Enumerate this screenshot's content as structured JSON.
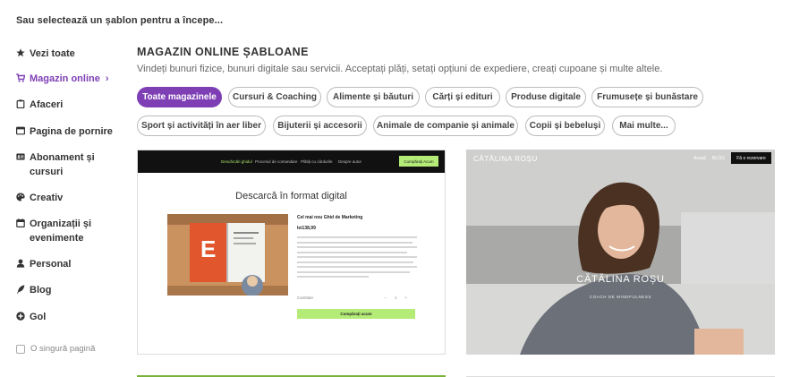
{
  "header": {
    "hint": "Sau selectează un șablon pentru a începe..."
  },
  "sidebar": {
    "items": [
      {
        "label": "Vezi toate",
        "icon": "star-icon"
      },
      {
        "label": "Magazin online",
        "icon": "cart-icon",
        "active": true,
        "chevron": "›"
      },
      {
        "label": "Afaceri",
        "icon": "clipboard-icon"
      },
      {
        "label": "Pagina de pornire",
        "icon": "browser-window-icon"
      },
      {
        "label": "Abonament și cursuri",
        "icon": "id-card-icon"
      },
      {
        "label": "Creativ",
        "icon": "palette-icon"
      },
      {
        "label": "Organizații și evenimente",
        "icon": "calendar-icon"
      },
      {
        "label": "Personal",
        "icon": "user-icon"
      },
      {
        "label": "Blog",
        "icon": "quill-icon"
      },
      {
        "label": "Gol",
        "icon": "plus-circle-icon"
      }
    ],
    "single_page_label": "O singură pagină"
  },
  "main": {
    "title": "MAGAZIN ONLINE ȘABLOANE",
    "description": "Vindeți bunuri fizice, bunuri digitale sau servicii. Acceptați plăți, setați opțiuni de expediere, creați cupoane și multe altele.",
    "filters": [
      {
        "label": "Toate magazinele",
        "active": true
      },
      {
        "label": "Cursuri & Coaching"
      },
      {
        "label": "Alimente și băuturi"
      },
      {
        "label": "Cărți și edituri"
      },
      {
        "label": "Produse digitale"
      },
      {
        "label": "Frumusețe și bunăstare"
      },
      {
        "label": "Sport și activități în aer liber"
      },
      {
        "label": "Bijuterii și accesorii"
      },
      {
        "label": "Animale de companie și animale"
      },
      {
        "label": "Copii și bebeluși"
      },
      {
        "label": "Mai multe..."
      }
    ]
  },
  "templates": {
    "digital": {
      "nav": [
        "Descărcări ghidul",
        "Procesul de comandare",
        "Plătiți cu cârdurile",
        "Despre autor"
      ],
      "nav_button": "Cumpărați Acum",
      "heading": "Descarcă în format digital",
      "product_title": "Cel mai nou Ghid de Marketing",
      "price": "lei138,99",
      "quantity_label": "Cantitate",
      "quantity": "1",
      "buy_button": "Cumpărați acum",
      "colors": {
        "accent": "#b4ec77",
        "nav_bg": "#111111",
        "cover": "#d97a3a"
      }
    },
    "coach": {
      "name": "CĂTĂLINA ROȘU",
      "nav": [
        "Acasă",
        "BLOG"
      ],
      "button": "Fă o rezervare",
      "title": "CĂTĂLINA ROȘU",
      "subtitle": "COACH DE MINDFULNESS"
    }
  },
  "colors": {
    "brand": "#7e3fb5",
    "text": "#333333",
    "muted": "#666666"
  }
}
